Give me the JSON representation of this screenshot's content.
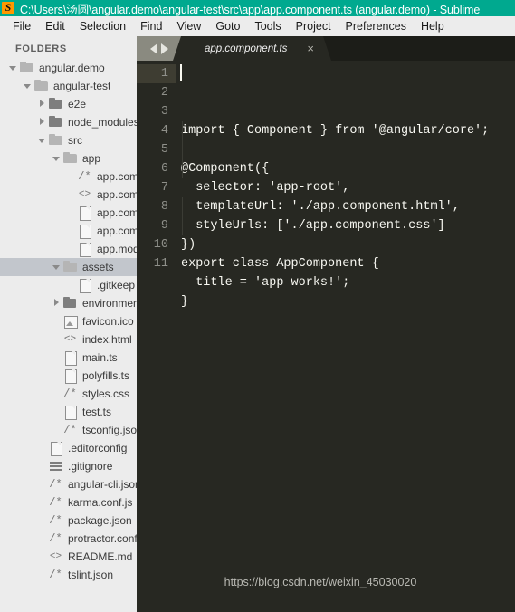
{
  "window": {
    "title": "C:\\Users\\汤圆\\angular.demo\\angular-test\\src\\app\\app.component.ts (angular.demo) - Sublime",
    "logo_icon": "sublime-text-logo",
    "titlebar_color": "#00a98f"
  },
  "menubar": {
    "items": [
      {
        "label": "File"
      },
      {
        "label": "Edit"
      },
      {
        "label": "Selection"
      },
      {
        "label": "Find"
      },
      {
        "label": "View"
      },
      {
        "label": "Goto"
      },
      {
        "label": "Tools"
      },
      {
        "label": "Project"
      },
      {
        "label": "Preferences"
      },
      {
        "label": "Help"
      }
    ]
  },
  "sidebar": {
    "header": "FOLDERS",
    "selected_index": 11,
    "items": [
      {
        "label": "angular.demo",
        "indent": 0,
        "arrow": "down",
        "icon": "folder-open-icon"
      },
      {
        "label": "angular-test",
        "indent": 1,
        "arrow": "down",
        "icon": "folder-open-icon"
      },
      {
        "label": "e2e",
        "indent": 2,
        "arrow": "right",
        "icon": "folder-closed-icon"
      },
      {
        "label": "node_modules",
        "indent": 2,
        "arrow": "right",
        "icon": "folder-closed-icon"
      },
      {
        "label": "src",
        "indent": 2,
        "arrow": "down",
        "icon": "folder-open-icon"
      },
      {
        "label": "app",
        "indent": 3,
        "arrow": "down",
        "icon": "folder-open-icon"
      },
      {
        "label": "app.component.css",
        "indent": 4,
        "arrow": "none",
        "icon": "comment-file-icon"
      },
      {
        "label": "app.component.html",
        "indent": 4,
        "arrow": "none",
        "icon": "markup-file-icon"
      },
      {
        "label": "app.component.spec.ts",
        "indent": 4,
        "arrow": "none",
        "icon": "plain-file-icon"
      },
      {
        "label": "app.component.ts",
        "indent": 4,
        "arrow": "none",
        "icon": "plain-file-icon"
      },
      {
        "label": "app.module.ts",
        "indent": 4,
        "arrow": "none",
        "icon": "plain-file-icon"
      },
      {
        "label": "assets",
        "indent": 3,
        "arrow": "down",
        "icon": "folder-open-icon"
      },
      {
        "label": ".gitkeep",
        "indent": 4,
        "arrow": "none",
        "icon": "plain-file-icon"
      },
      {
        "label": "environments",
        "indent": 3,
        "arrow": "right",
        "icon": "folder-closed-icon"
      },
      {
        "label": "favicon.ico",
        "indent": 3,
        "arrow": "none",
        "icon": "image-file-icon"
      },
      {
        "label": "index.html",
        "indent": 3,
        "arrow": "none",
        "icon": "markup-file-icon"
      },
      {
        "label": "main.ts",
        "indent": 3,
        "arrow": "none",
        "icon": "plain-file-icon"
      },
      {
        "label": "polyfills.ts",
        "indent": 3,
        "arrow": "none",
        "icon": "plain-file-icon"
      },
      {
        "label": "styles.css",
        "indent": 3,
        "arrow": "none",
        "icon": "comment-file-icon"
      },
      {
        "label": "test.ts",
        "indent": 3,
        "arrow": "none",
        "icon": "plain-file-icon"
      },
      {
        "label": "tsconfig.json",
        "indent": 3,
        "arrow": "none",
        "icon": "comment-file-icon"
      },
      {
        "label": ".editorconfig",
        "indent": 2,
        "arrow": "none",
        "icon": "plain-file-icon"
      },
      {
        "label": ".gitignore",
        "indent": 2,
        "arrow": "none",
        "icon": "textlines-file-icon"
      },
      {
        "label": "angular-cli.json",
        "indent": 2,
        "arrow": "none",
        "icon": "comment-file-icon"
      },
      {
        "label": "karma.conf.js",
        "indent": 2,
        "arrow": "none",
        "icon": "comment-file-icon"
      },
      {
        "label": "package.json",
        "indent": 2,
        "arrow": "none",
        "icon": "comment-file-icon"
      },
      {
        "label": "protractor.conf.js",
        "indent": 2,
        "arrow": "none",
        "icon": "comment-file-icon"
      },
      {
        "label": "README.md",
        "indent": 2,
        "arrow": "none",
        "icon": "markup-file-icon"
      },
      {
        "label": "tslint.json",
        "indent": 2,
        "arrow": "none",
        "icon": "comment-file-icon"
      }
    ]
  },
  "editor": {
    "nav": {
      "prev_icon": "arrow-left-icon",
      "next_icon": "arrow-right-icon"
    },
    "tabs": [
      {
        "label": "app.component.ts",
        "close_icon": "close-icon",
        "active": true
      }
    ],
    "active_line": 1,
    "line_numbers": [
      "1",
      "2",
      "3",
      "4",
      "5",
      "6",
      "7",
      "8",
      "9",
      "10",
      "11"
    ],
    "code_lines": [
      "import { Component } from '@angular/core';",
      "",
      "@Component({",
      "  selector: 'app-root',",
      "  templateUrl: './app.component.html',",
      "  styleUrls: ['./app.component.css']",
      "})",
      "export class AppComponent {",
      "  title = 'app works!';",
      "}",
      ""
    ],
    "background": "#272822",
    "foreground": "#f8f8f2"
  },
  "watermark": {
    "text": "https://blog.csdn.net/weixin_45030020"
  }
}
